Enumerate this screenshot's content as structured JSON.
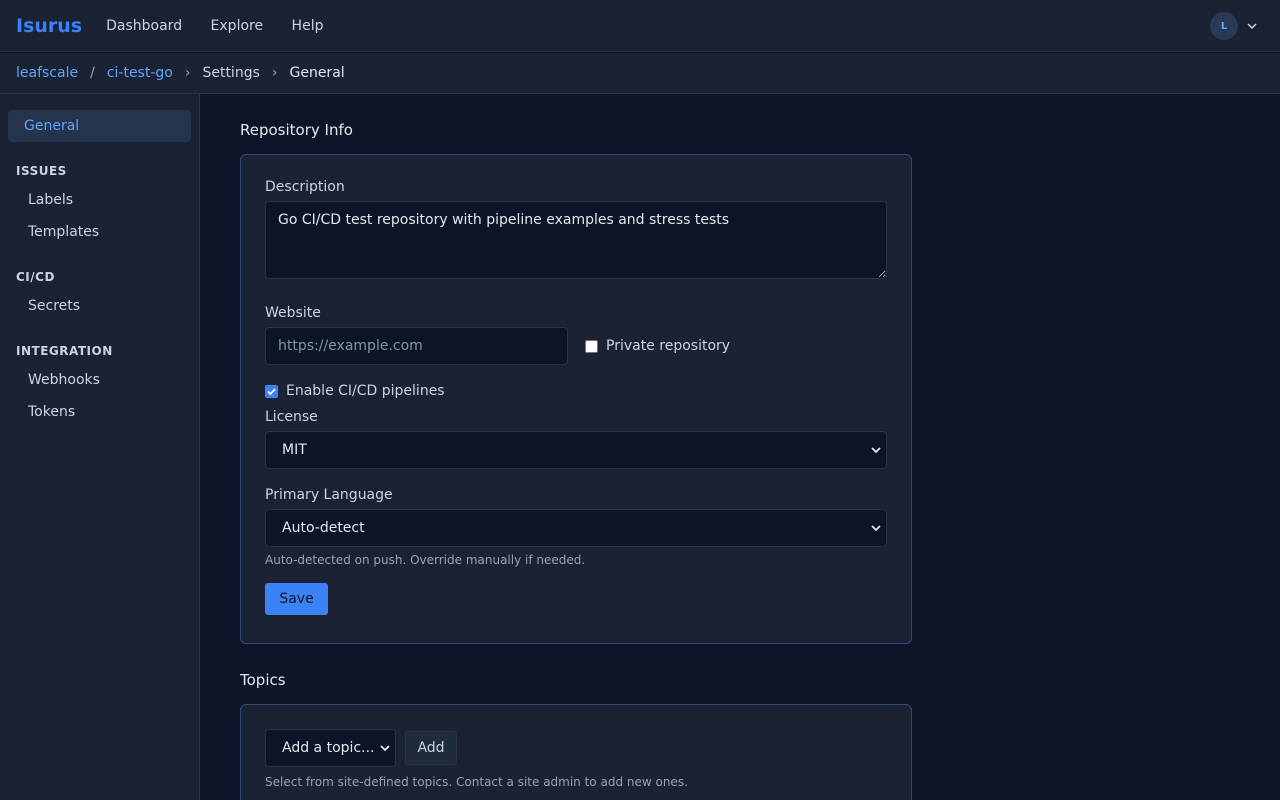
{
  "topbar": {
    "brand": "Isurus",
    "nav": [
      "Dashboard",
      "Explore",
      "Help"
    ],
    "avatar_initial": "L"
  },
  "breadcrumb": {
    "org": "leafscale",
    "repo": "ci-test-go",
    "section": "Settings",
    "page": "General",
    "sep_slash": "/",
    "sep_chevron": "›"
  },
  "sidebar": {
    "active": "General",
    "groups": [
      {
        "heading": "ISSUES",
        "items": [
          "Labels",
          "Templates"
        ]
      },
      {
        "heading": "CI/CD",
        "items": [
          "Secrets"
        ]
      },
      {
        "heading": "INTEGRATION",
        "items": [
          "Webhooks",
          "Tokens"
        ]
      }
    ]
  },
  "repo_info": {
    "title": "Repository Info",
    "description_label": "Description",
    "description_value": "Go CI/CD test repository with pipeline examples and stress tests",
    "website_label": "Website",
    "website_placeholder": "https://example.com",
    "private_label": "Private repository",
    "private_checked": false,
    "cicd_label": "Enable CI/CD pipelines",
    "cicd_checked": true,
    "license_label": "License",
    "license_value": "MIT",
    "language_label": "Primary Language",
    "language_value": "Auto-detect",
    "language_hint": "Auto-detected on push. Override manually if needed.",
    "save_label": "Save"
  },
  "topics": {
    "title": "Topics",
    "select_value": "Add a topic...",
    "add_label": "Add",
    "hint": "Select from site-defined topics. Contact a site admin to add new ones."
  },
  "colors": {
    "accent": "#3b82f6",
    "background": "#0c1527",
    "panel": "#1a2233"
  }
}
